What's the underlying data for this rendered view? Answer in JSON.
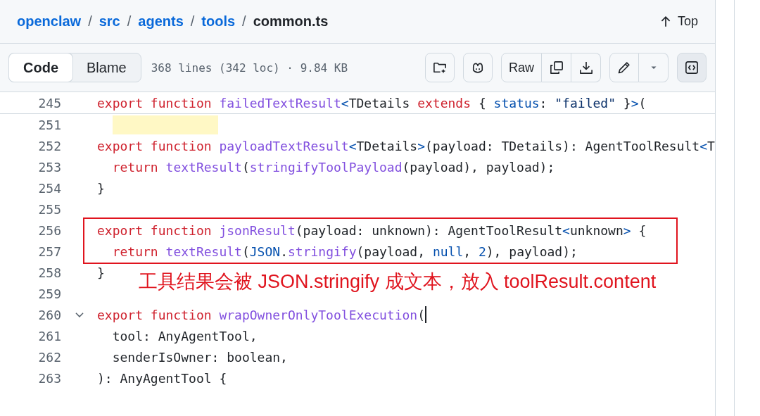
{
  "breadcrumb": [
    {
      "text": "openclaw",
      "kind": "link"
    },
    {
      "text": "src",
      "kind": "link"
    },
    {
      "text": "agents",
      "kind": "link"
    },
    {
      "text": "tools",
      "kind": "link"
    },
    {
      "text": "common.ts",
      "kind": "current"
    }
  ],
  "breadcrumb_separator": "/",
  "top_button": {
    "label": "Top"
  },
  "tabs": [
    {
      "label": "Code",
      "selected": true
    },
    {
      "label": "Blame",
      "selected": false
    }
  ],
  "file_info": "368 lines (342 loc) · 9.84 KB",
  "raw_button": {
    "label": "Raw"
  },
  "symbols_button": {
    "selected": true
  },
  "sticky_line": {
    "number": "245",
    "tokens": [
      {
        "kind": "keyword",
        "text": "export "
      },
      {
        "kind": "keyword",
        "text": "function "
      },
      {
        "kind": "entity",
        "text": "failedTextResult"
      },
      {
        "kind": "constant",
        "text": "<"
      },
      {
        "kind": "plain",
        "text": "TDetails "
      },
      {
        "kind": "keyword",
        "text": "extends"
      },
      {
        "kind": "plain",
        "text": " { "
      },
      {
        "kind": "constant",
        "text": "status"
      },
      {
        "kind": "plain",
        "text": ": "
      },
      {
        "kind": "string",
        "text": "\"failed\""
      },
      {
        "kind": "plain",
        "text": " }"
      },
      {
        "kind": "constant",
        "text": ">"
      },
      {
        "kind": "plain",
        "text": "("
      }
    ]
  },
  "lines": [
    {
      "number": "251",
      "highlighted": true
    },
    {
      "number": "252",
      "tokens": [
        {
          "kind": "keyword",
          "text": "export "
        },
        {
          "kind": "keyword",
          "text": "function "
        },
        {
          "kind": "entity",
          "text": "payloadTextResult"
        },
        {
          "kind": "constant",
          "text": "<"
        },
        {
          "kind": "plain",
          "text": "TDetails"
        },
        {
          "kind": "constant",
          "text": ">"
        },
        {
          "kind": "plain",
          "text": "(payload: TDetails): AgentToolResult"
        },
        {
          "kind": "constant",
          "text": "<"
        },
        {
          "kind": "plain",
          "text": "T"
        }
      ]
    },
    {
      "number": "253",
      "tokens": [
        {
          "kind": "keyword",
          "text": "  return "
        },
        {
          "kind": "entity",
          "text": "textResult"
        },
        {
          "kind": "plain",
          "text": "("
        },
        {
          "kind": "entity",
          "text": "stringifyToolPayload"
        },
        {
          "kind": "plain",
          "text": "(payload), payload);"
        }
      ]
    },
    {
      "number": "254",
      "tokens": [
        {
          "kind": "plain",
          "text": "}"
        }
      ]
    },
    {
      "number": "255"
    },
    {
      "number": "256",
      "tokens": [
        {
          "kind": "keyword",
          "text": "export "
        },
        {
          "kind": "keyword",
          "text": "function "
        },
        {
          "kind": "entity",
          "text": "jsonResult"
        },
        {
          "kind": "plain",
          "text": "(payload: unknown): AgentToolResult"
        },
        {
          "kind": "constant",
          "text": "<"
        },
        {
          "kind": "plain",
          "text": "unknown"
        },
        {
          "kind": "constant",
          "text": ">"
        },
        {
          "kind": "plain",
          "text": " {"
        }
      ],
      "boxed": true
    },
    {
      "number": "257",
      "tokens": [
        {
          "kind": "keyword",
          "text": "  return "
        },
        {
          "kind": "entity",
          "text": "textResult"
        },
        {
          "kind": "plain",
          "text": "("
        },
        {
          "kind": "constant",
          "text": "JSON"
        },
        {
          "kind": "plain",
          "text": "."
        },
        {
          "kind": "entity",
          "text": "stringify"
        },
        {
          "kind": "plain",
          "text": "(payload, "
        },
        {
          "kind": "constant",
          "text": "null"
        },
        {
          "kind": "plain",
          "text": ", "
        },
        {
          "kind": "constant",
          "text": "2"
        },
        {
          "kind": "plain",
          "text": "), payload);"
        }
      ],
      "boxed": true
    },
    {
      "number": "258",
      "tokens": [
        {
          "kind": "plain",
          "text": "}"
        }
      ]
    },
    {
      "number": "259"
    },
    {
      "number": "260",
      "tokens": [
        {
          "kind": "keyword",
          "text": "export "
        },
        {
          "kind": "keyword",
          "text": "function "
        },
        {
          "kind": "entity",
          "text": "wrapOwnerOnlyToolExecution"
        },
        {
          "kind": "plain",
          "text": "("
        }
      ],
      "expandable": true,
      "cursor": true
    },
    {
      "number": "261",
      "tokens": [
        {
          "kind": "plain",
          "text": "  tool: AnyAgentTool,"
        }
      ]
    },
    {
      "number": "262",
      "tokens": [
        {
          "kind": "plain",
          "text": "  senderIsOwner: boolean,"
        }
      ]
    },
    {
      "number": "263",
      "tokens": [
        {
          "kind": "plain",
          "text": "): AnyAgentTool {"
        }
      ]
    }
  ],
  "annotation": {
    "text": "工具结果会被 JSON.stringify 成文本，放入 toolResult.content"
  }
}
